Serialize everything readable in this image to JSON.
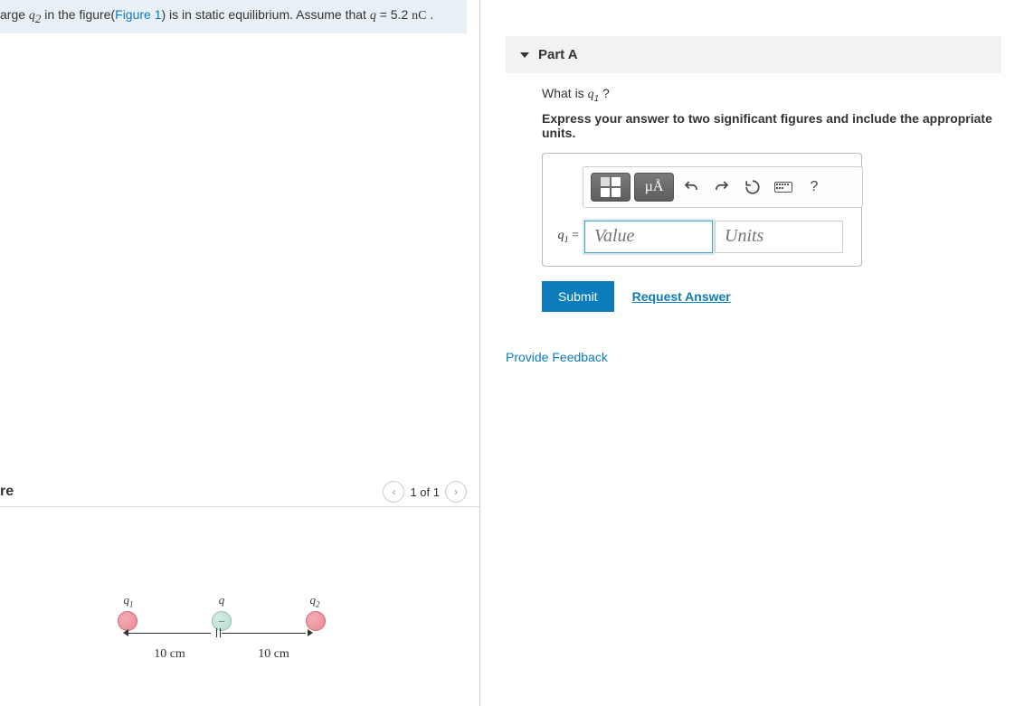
{
  "problem": {
    "text_prefix": "arge ",
    "var1": "q",
    "var1_sub": "2",
    "text_mid1": " in the figure(",
    "figure_link": "Figure 1",
    "text_mid2": ") is in static equilibrium. Assume that ",
    "var2": "q",
    "text_eq": " = 5.2 ",
    "unit": "nC",
    "text_end": " ."
  },
  "figure": {
    "header": "re",
    "counter": "1 of 1",
    "labels": {
      "q1": "q",
      "q1_sub": "1",
      "q": "q",
      "q2": "q",
      "q2_sub": "2"
    },
    "dist_left": "10 cm",
    "dist_right": "10 cm",
    "minus": "−"
  },
  "part": {
    "title": "Part A",
    "question_prefix": "What is ",
    "question_var": "q",
    "question_sub": "1",
    "question_suffix": " ?",
    "instruction": "Express your answer to two significant figures and include the appropriate units.",
    "lhs_var": "q",
    "lhs_sub": "1",
    "lhs_eq": " = ",
    "value_placeholder": "Value",
    "units_placeholder": "Units",
    "toolbar": {
      "units_label": "µÅ",
      "help_label": "?"
    },
    "submit_label": "Submit",
    "request_label": "Request Answer"
  },
  "feedback_label": "Provide Feedback"
}
